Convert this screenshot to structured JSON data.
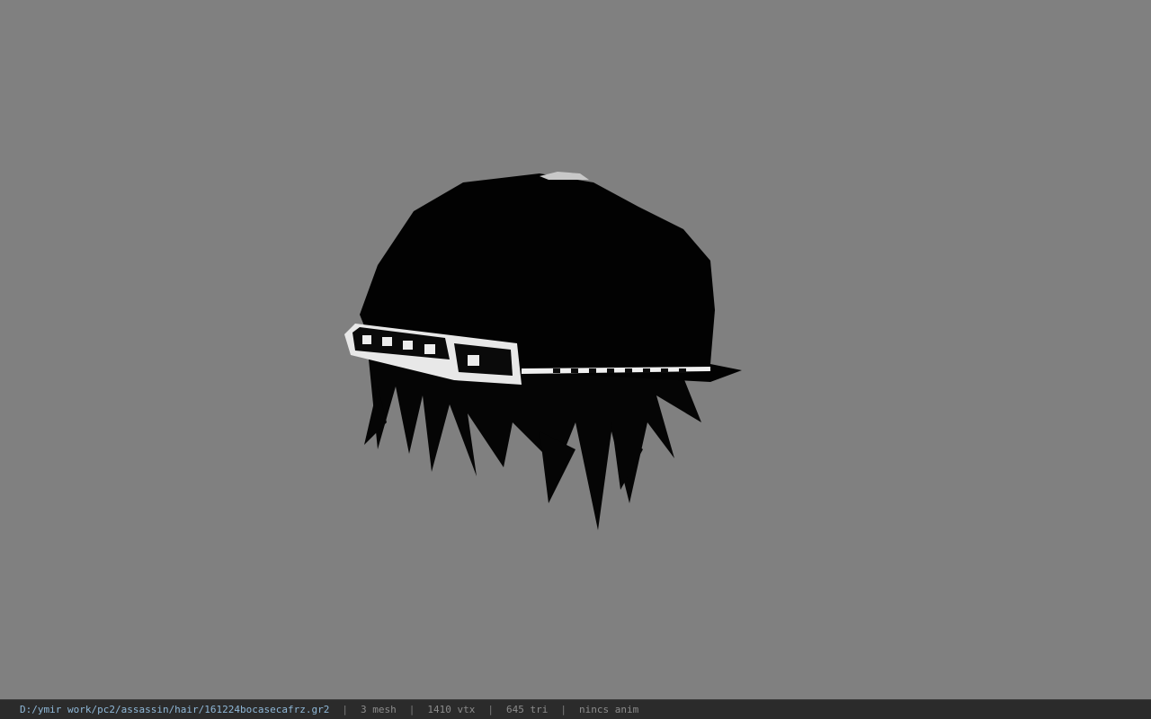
{
  "viewport": {
    "background": "#808080",
    "model": "hair-with-cap"
  },
  "status": {
    "file_path": "D:/ymir work/pc2/assassin/hair/161224bocasecafrz.gr2",
    "separator": "|",
    "mesh_count": "3 mesh",
    "vertex_count": "1410 vtx",
    "triangle_count": "645 tri",
    "animation": "nincs anim"
  }
}
